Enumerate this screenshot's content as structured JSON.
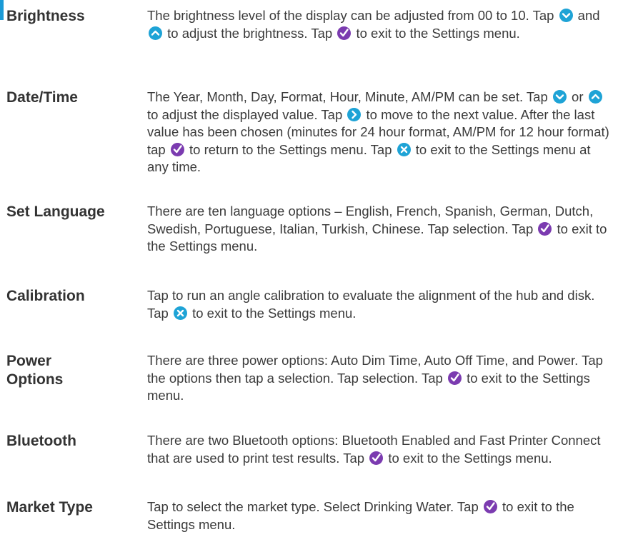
{
  "colors": {
    "accent": "#1a9ad6",
    "icon_blue": "#1ea3d6",
    "icon_purple": "#7b3bb0"
  },
  "icons": {
    "down": "chevron-down-icon",
    "up": "chevron-up-icon",
    "right": "chevron-right-icon",
    "check": "check-icon",
    "close": "close-icon"
  },
  "sections": [
    {
      "term": "Brightness",
      "parts": [
        "The brightness level of the display can be adjusted from 00 to 10. Tap ",
        " and ",
        " to adjust the brightness. Tap ",
        " to exit to the Settings menu."
      ]
    },
    {
      "term": "Date/Time",
      "parts": [
        "The Year, Month, Day, Format, Hour, Minute, AM/PM can be set. Tap ",
        " or ",
        " to adjust the displayed value. Tap ",
        " to move to the next value. After the last value has been chosen (minutes for 24 hour format, AM/PM for 12 hour format) tap ",
        " to return to the Settings menu. Tap ",
        " to exit to the Settings menu at any time."
      ]
    },
    {
      "term": "Set Language",
      "parts": [
        "There are ten language options – English, French, Spanish, German, Dutch, Swedish, Portuguese, Italian, Turkish, Chinese. Tap selection. Tap ",
        " to exit to the Settings menu."
      ]
    },
    {
      "term": "Calibration",
      "parts": [
        "Tap to run an angle calibration to evaluate the alignment of the hub and disk. Tap ",
        " to exit to the Settings menu."
      ]
    },
    {
      "term_line1": "Power",
      "term_line2": "Options",
      "parts": [
        "There are three power options: Auto Dim Time, Auto Off Time, and Power. Tap the options then tap a selection. Tap selection. Tap ",
        " to exit to the Settings menu."
      ]
    },
    {
      "term": "Bluetooth",
      "parts": [
        "There are two Bluetooth options: Bluetooth Enabled and Fast Printer Connect that are used to print test results. Tap ",
        " to exit to the Settings menu."
      ]
    },
    {
      "term": "Market Type",
      "parts": [
        "Tap to select the market type. Select Drinking Water. Tap ",
        " to exit to the Settings menu."
      ]
    }
  ]
}
